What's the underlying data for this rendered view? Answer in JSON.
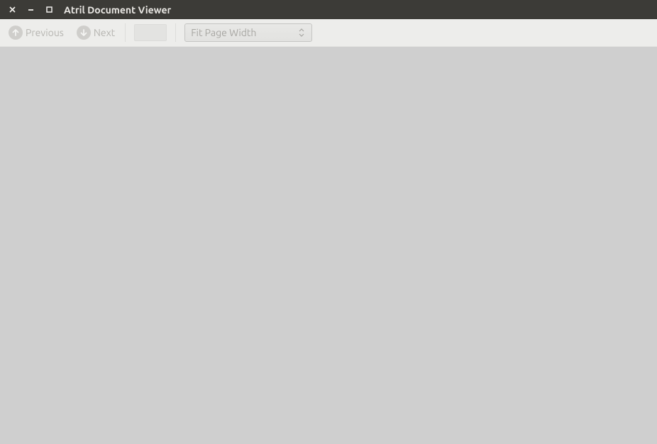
{
  "window": {
    "title": "Atril Document Viewer"
  },
  "toolbar": {
    "previous_label": "Previous",
    "next_label": "Next",
    "zoom_mode": "Fit Page Width",
    "page_input_value": ""
  }
}
